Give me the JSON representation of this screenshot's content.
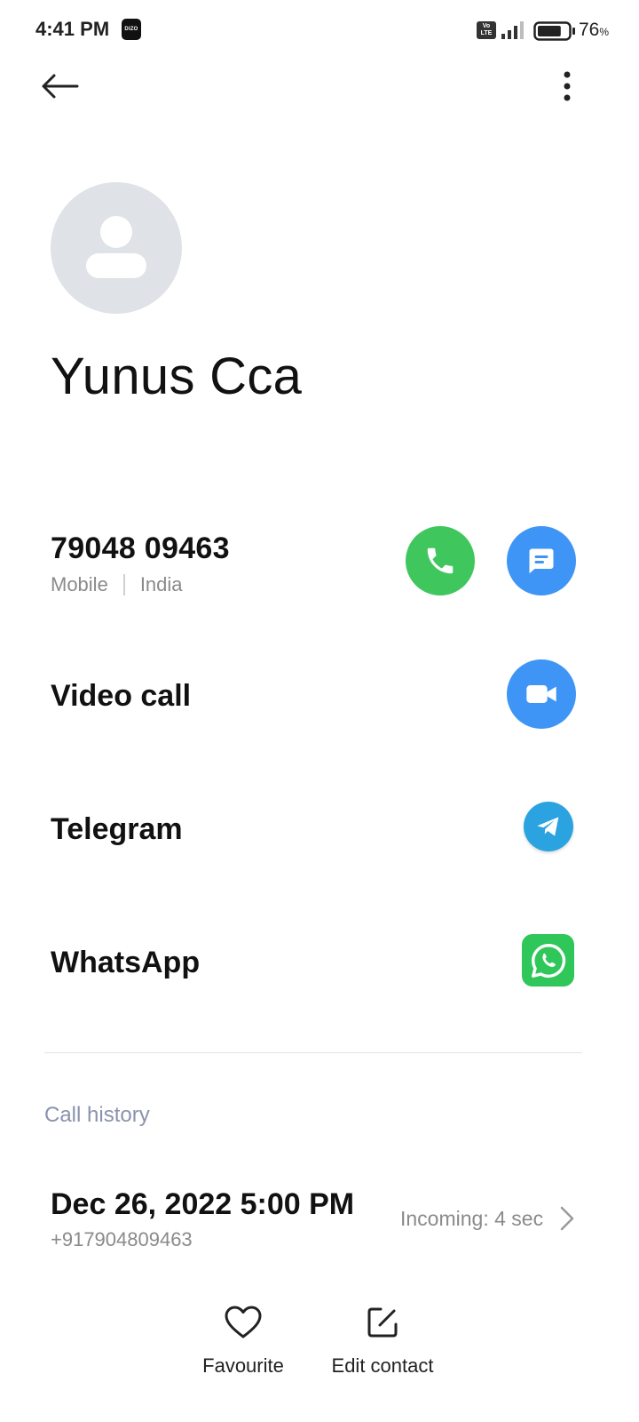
{
  "status_bar": {
    "time": "4:41 PM",
    "badge_text": "DIZO",
    "volte_text": "Vo LTE",
    "battery_percent": "76",
    "battery_unit": "%",
    "battery_level": 0.76
  },
  "toolbar": {
    "back_icon": "arrow-left-icon",
    "more_icon": "more-vertical-icon"
  },
  "contact": {
    "name": "Yunus Cca",
    "avatar_icon": "person-icon"
  },
  "phone": {
    "number": "79048 09463",
    "type": "Mobile",
    "country": "India",
    "call_icon": "phone-icon",
    "message_icon": "message-icon",
    "call_color": "#3fc75e",
    "message_color": "#3e95f6"
  },
  "apps": {
    "video_call_label": "Video call",
    "telegram_label": "Telegram",
    "whatsapp_label": "WhatsApp",
    "video_icon": "video-camera-icon",
    "telegram_icon": "telegram-icon",
    "whatsapp_icon": "whatsapp-icon"
  },
  "call_history": {
    "title": "Call history",
    "items": [
      {
        "datetime": "Dec 26, 2022 5:00 PM",
        "number": "+917904809463",
        "status": "Incoming: 4 sec"
      }
    ]
  },
  "bottom_bar": {
    "favourite_label": "Favourite",
    "edit_label": "Edit contact",
    "favourite_icon": "heart-icon",
    "edit_icon": "edit-icon"
  }
}
